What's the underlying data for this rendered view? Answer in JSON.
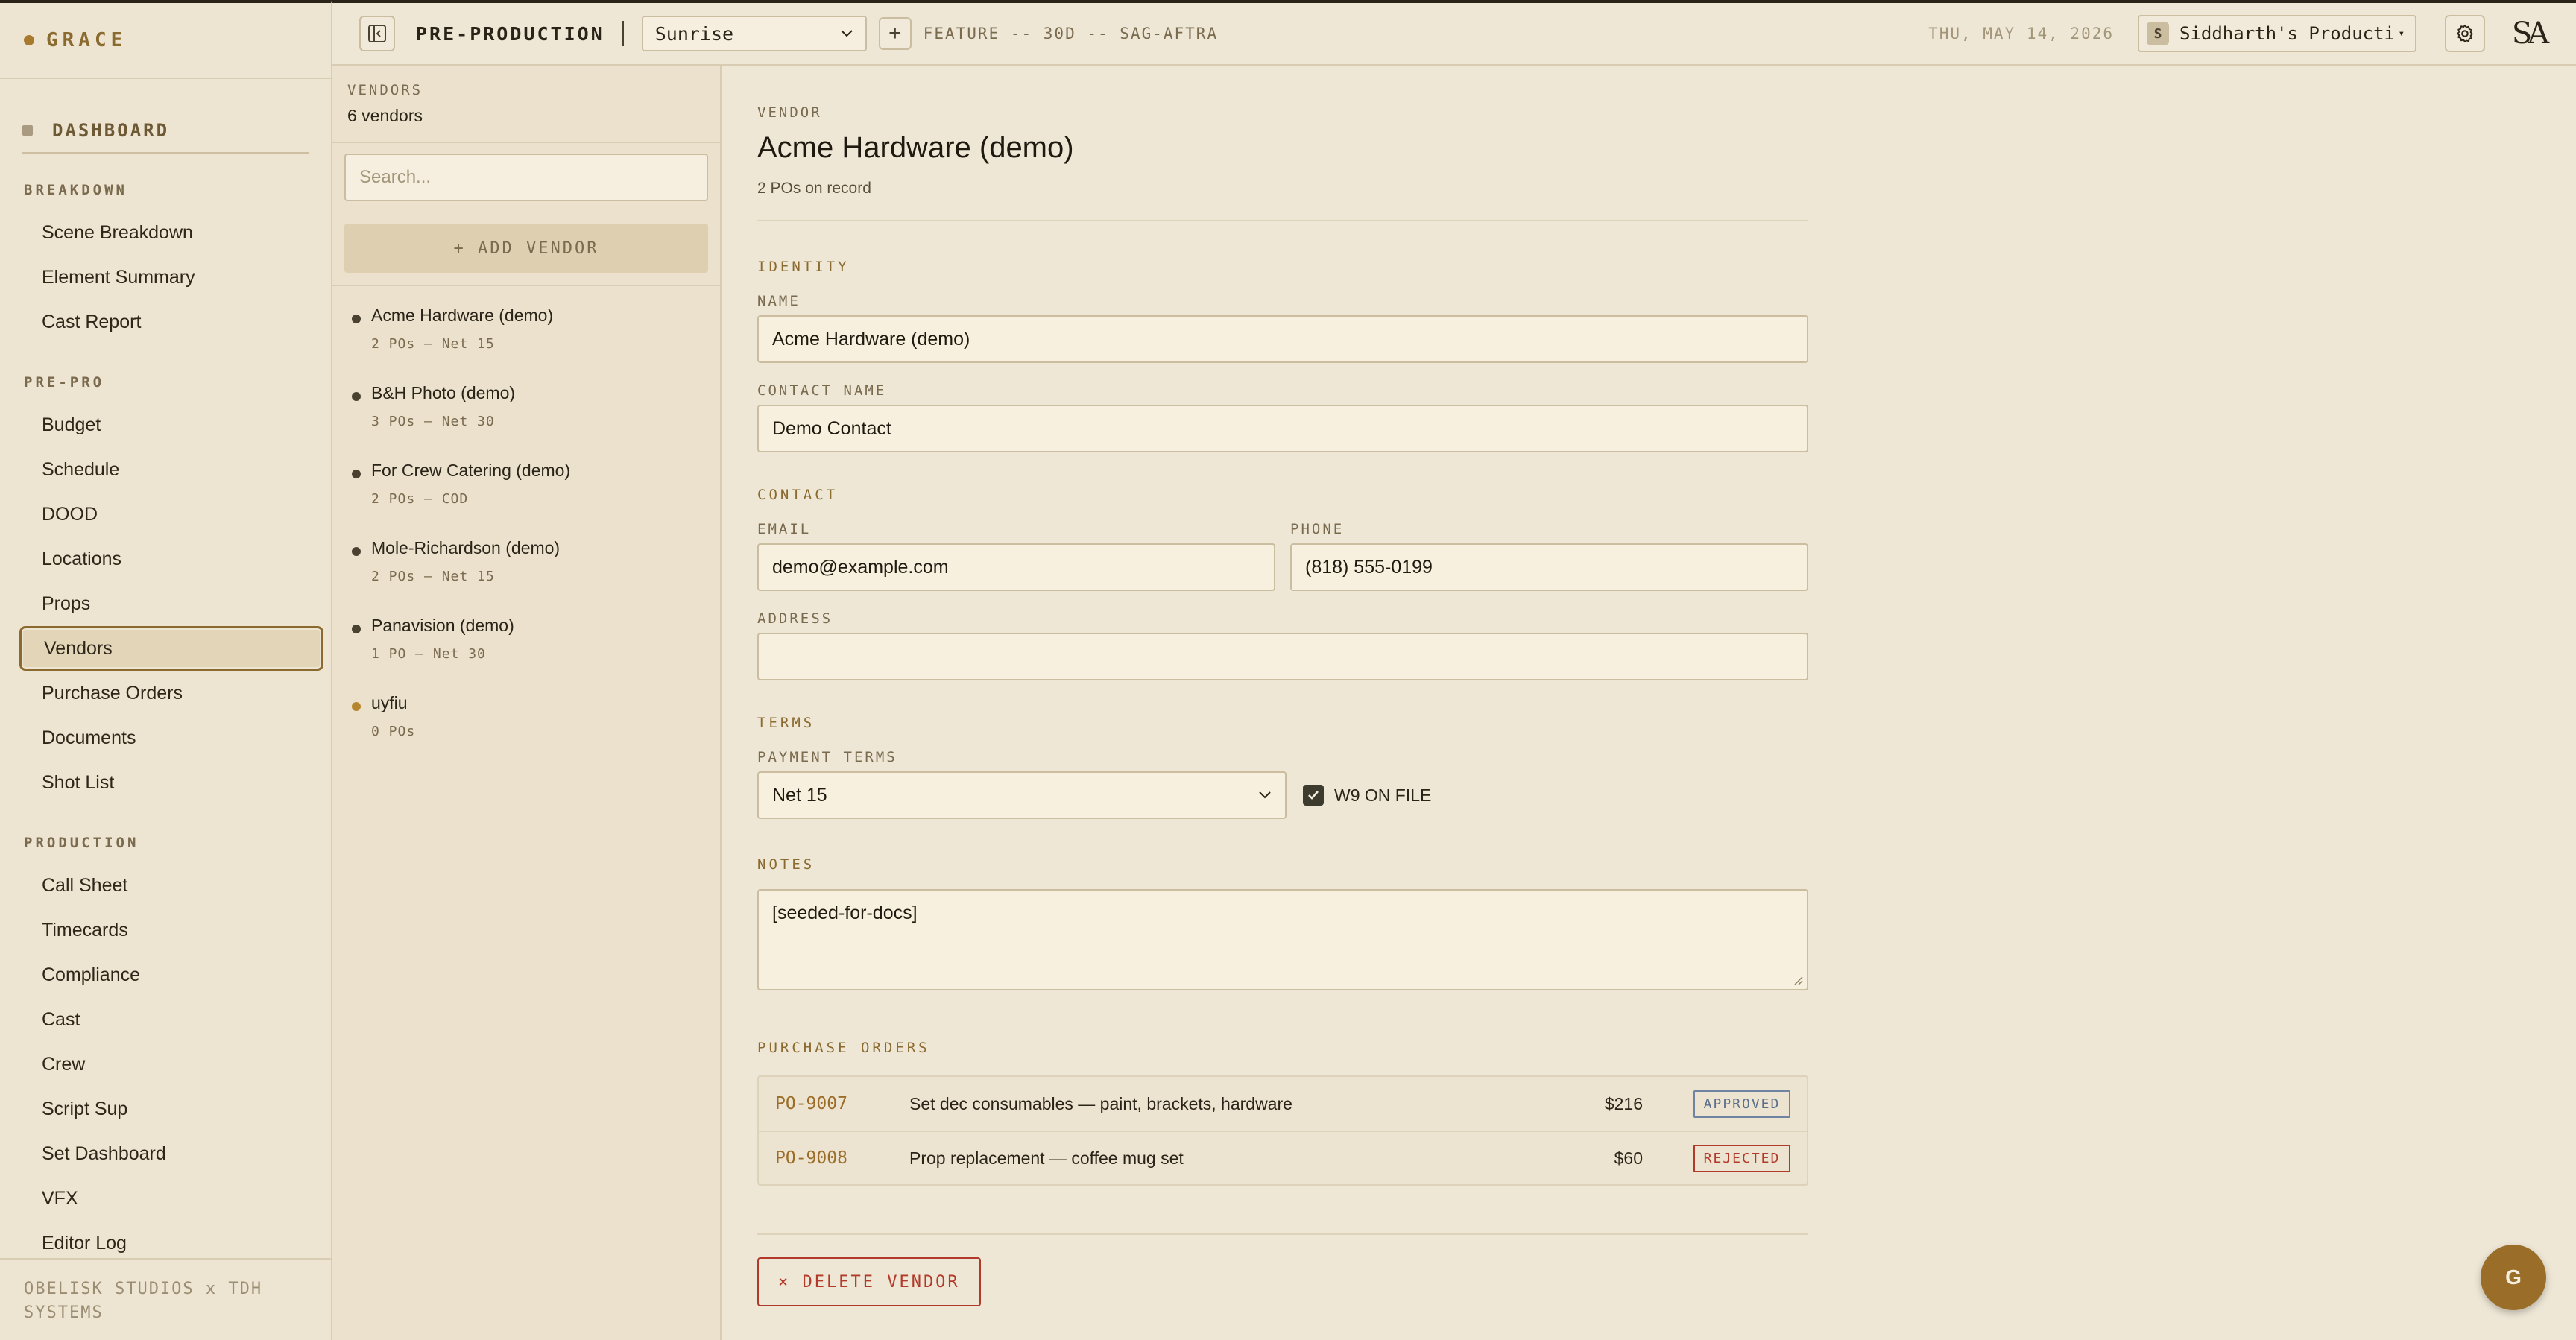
{
  "brand": {
    "name": "GRACE"
  },
  "sidebar": {
    "dashboard_label": "DASHBOARD",
    "sections": [
      {
        "label": "BREAKDOWN",
        "items": [
          "Scene Breakdown",
          "Element Summary",
          "Cast Report"
        ]
      },
      {
        "label": "PRE-PRO",
        "items": [
          "Budget",
          "Schedule",
          "DOOD",
          "Locations",
          "Props",
          "Vendors",
          "Purchase Orders",
          "Documents",
          "Shot List"
        ]
      },
      {
        "label": "PRODUCTION",
        "items": [
          "Call Sheet",
          "Timecards",
          "Compliance",
          "Cast",
          "Crew",
          "Script Sup",
          "Set Dashboard",
          "VFX",
          "Editor Log"
        ]
      }
    ],
    "active_item": "Vendors",
    "footer": "OBELISK STUDIOS x TDH SYSTEMS"
  },
  "topbar": {
    "breadcrumb": "PRE-PRODUCTION",
    "project": "Sunrise",
    "project_meta": "FEATURE -- 30D -- SAG-AFTRA",
    "date": "THU, MAY 14, 2026",
    "org_badge": "S",
    "org_name": "Siddharth's Producti…",
    "avatar_text": "SA"
  },
  "vendor_list": {
    "header_label": "VENDORS",
    "count": "6 vendors",
    "search_placeholder": "Search...",
    "add_label": "+ ADD VENDOR",
    "items": [
      {
        "name": "Acme Hardware (demo)",
        "sub": "2 POs — Net 15"
      },
      {
        "name": "B&H Photo (demo)",
        "sub": "3 POs — Net 30"
      },
      {
        "name": "For Crew Catering (demo)",
        "sub": "2 POs — COD"
      },
      {
        "name": "Mole-Richardson (demo)",
        "sub": "2 POs — Net 15"
      },
      {
        "name": "Panavision (demo)",
        "sub": "1 PO — Net 30"
      },
      {
        "name": "uyfiu",
        "sub": "0 POs"
      }
    ]
  },
  "detail": {
    "eyebrow": "VENDOR",
    "title": "Acme Hardware (demo)",
    "subtitle": "2 POs on record",
    "identity_label": "IDENTITY",
    "name_label": "NAME",
    "name_value": "Acme Hardware (demo)",
    "contact_name_label": "CONTACT NAME",
    "contact_name_value": "Demo Contact",
    "contact_label": "CONTACT",
    "email_label": "EMAIL",
    "email_value": "demo@example.com",
    "phone_label": "PHONE",
    "phone_value": "(818) 555-0199",
    "address_label": "ADDRESS",
    "address_value": "",
    "terms_label": "TERMS",
    "payment_terms_label": "PAYMENT TERMS",
    "payment_terms_value": "Net 15",
    "w9_label": "W9 ON FILE",
    "w9_checked": true,
    "notes_label": "NOTES",
    "notes_value": "[seeded-for-docs]",
    "po_label": "PURCHASE ORDERS",
    "purchase_orders": [
      {
        "id": "PO-9007",
        "desc": "Set dec consumables — paint, brackets, hardware",
        "amount": "$216",
        "status": "APPROVED"
      },
      {
        "id": "PO-9008",
        "desc": "Prop replacement — coffee mug set",
        "amount": "$60",
        "status": "REJECTED"
      }
    ],
    "delete_label": "× DELETE VENDOR"
  },
  "fab_label": "G",
  "colors": {
    "accent": "#9a6e28",
    "background": "#efe7d6",
    "danger": "#b23a2a",
    "approved": "#5a6f8a"
  }
}
